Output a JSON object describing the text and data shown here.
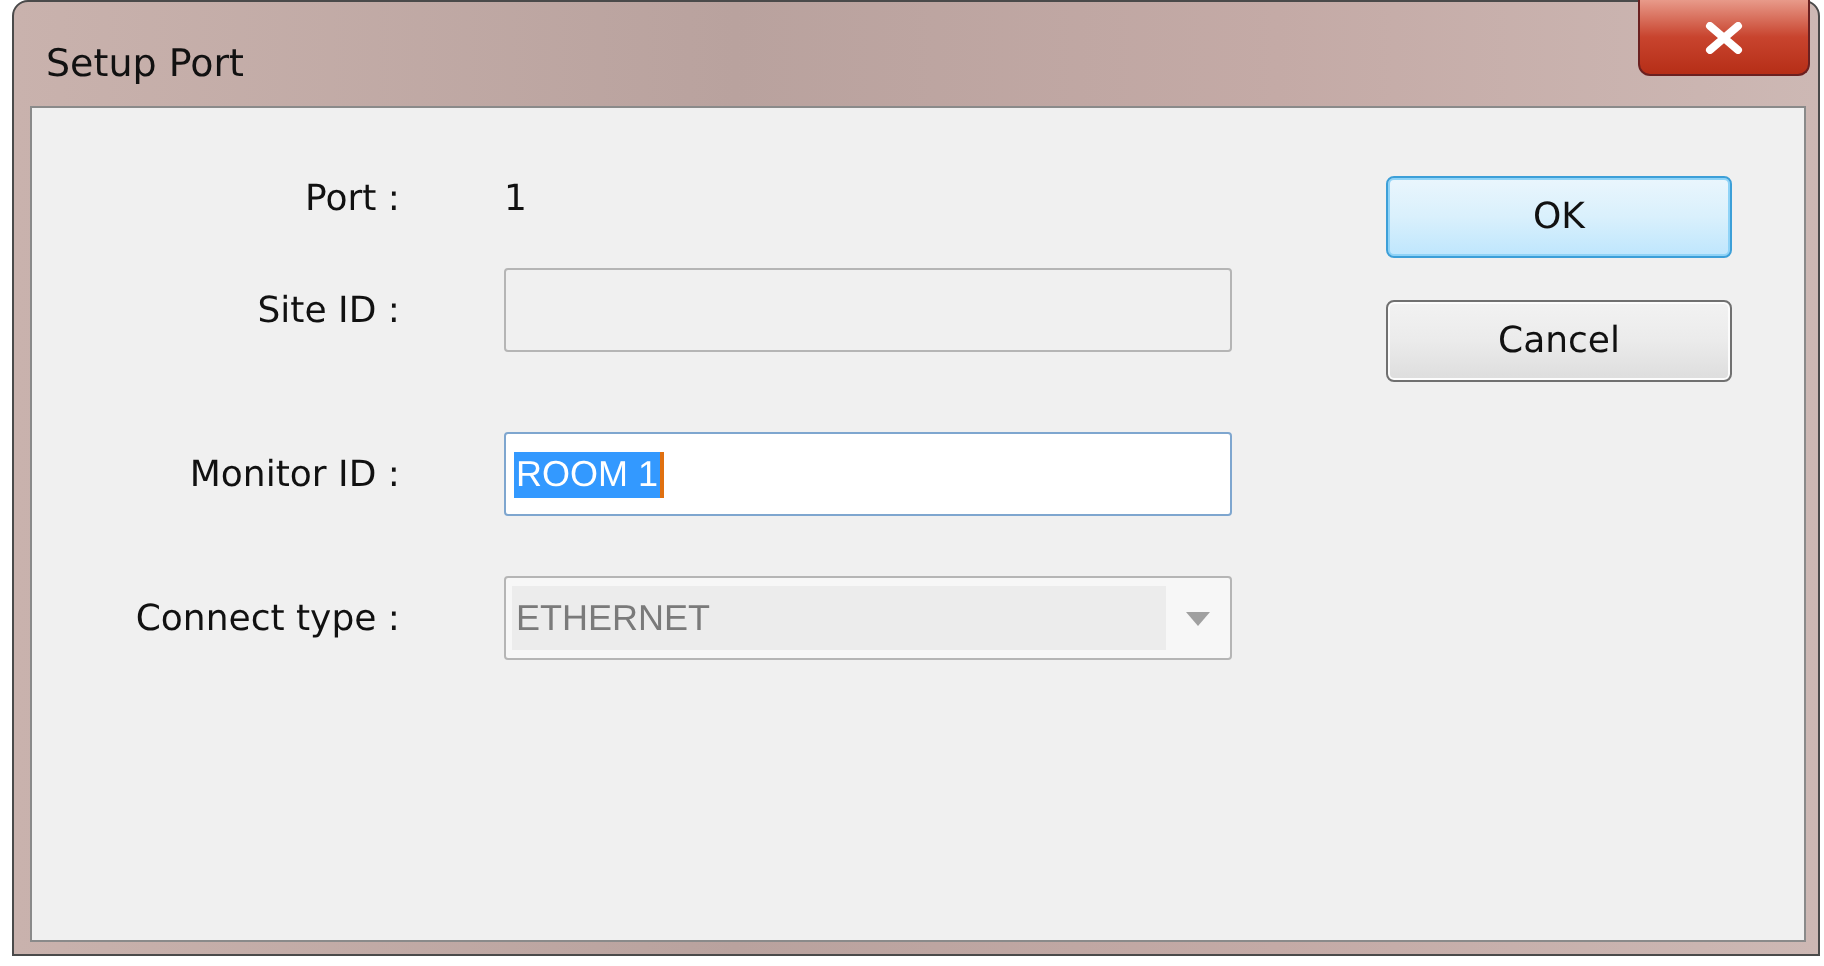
{
  "window": {
    "title": "Setup Port"
  },
  "fields": [
    {
      "kind": "text",
      "label": "Port :",
      "value": "1"
    },
    {
      "kind": "input",
      "label": "Site ID :",
      "disabled": true
    },
    {
      "kind": "input",
      "label": "Monitor ID :",
      "value": "ROOM 1",
      "disabled": false,
      "text_selected": true
    },
    {
      "kind": "combo",
      "label": "Connect type :",
      "value": "ETHERNET",
      "disabled": true
    }
  ],
  "buttons": [
    {
      "label": "OK",
      "default": true
    },
    {
      "label": "Cancel",
      "default": false
    }
  ]
}
